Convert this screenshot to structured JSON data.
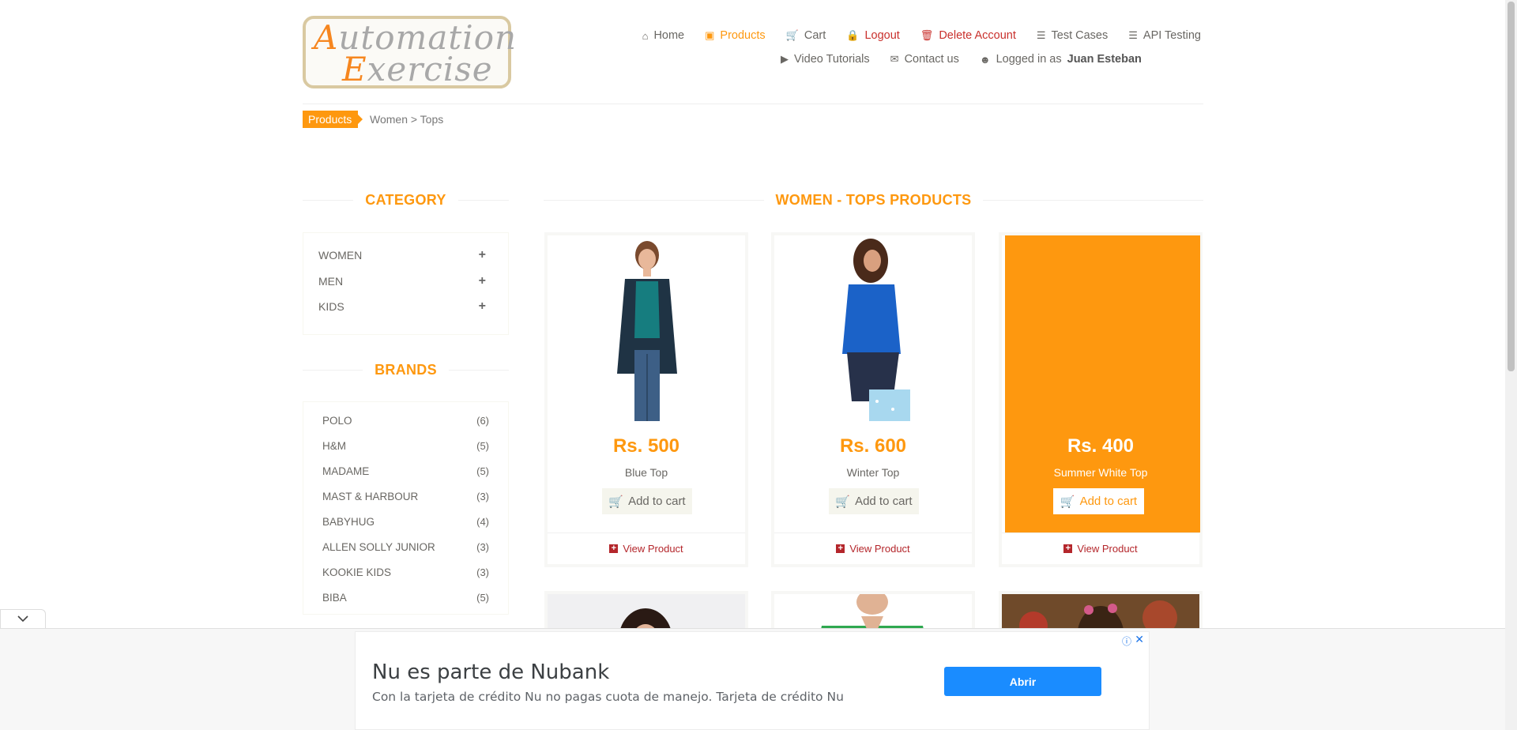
{
  "logo": {
    "line1_cap": "A",
    "line1_rest": "utomation",
    "line2_cap": "E",
    "line2_rest": "xercise"
  },
  "nav": {
    "home": "Home",
    "products": "Products",
    "cart": "Cart",
    "logout": "Logout",
    "delete_account": "Delete Account",
    "test_cases": "Test Cases",
    "api_testing": "API Testing",
    "video_tutorials": "Video Tutorials",
    "contact_us": "Contact us",
    "logged_in_prefix": "Logged in as",
    "logged_in_user": "Juan Esteban"
  },
  "breadcrumb": {
    "tag": "Products",
    "path": "Women > Tops"
  },
  "sidebar": {
    "category_title": "CATEGORY",
    "categories": [
      {
        "label": "WOMEN",
        "icon": "plus-icon"
      },
      {
        "label": "MEN",
        "icon": "plus-icon"
      },
      {
        "label": "KIDS",
        "icon": "plus-icon"
      }
    ],
    "brands_title": "BRANDS",
    "brands": [
      {
        "label": "POLO",
        "count": "(6)"
      },
      {
        "label": "H&M",
        "count": "(5)"
      },
      {
        "label": "MADAME",
        "count": "(5)"
      },
      {
        "label": "MAST & HARBOUR",
        "count": "(3)"
      },
      {
        "label": "BABYHUG",
        "count": "(4)"
      },
      {
        "label": "ALLEN SOLLY JUNIOR",
        "count": "(3)"
      },
      {
        "label": "KOOKIE KIDS",
        "count": "(3)"
      },
      {
        "label": "BIBA",
        "count": "(5)"
      }
    ]
  },
  "main": {
    "title": "WOMEN - TOPS PRODUCTS",
    "products": [
      {
        "price": "Rs. 500",
        "name": "Blue Top",
        "add_to_cart": "Add to cart",
        "view": "View Product"
      },
      {
        "price": "Rs. 600",
        "name": "Winter Top",
        "add_to_cart": "Add to cart",
        "view": "View Product"
      },
      {
        "price": "Rs. 400",
        "name": "Summer White Top",
        "add_to_cart": "Add to cart",
        "view": "View Product"
      }
    ]
  },
  "ad": {
    "title": "Nu es parte de Nubank",
    "text": "Con la tarjeta de crédito Nu no pagas cuota de manejo. Tarjeta de crédito Nu",
    "button": "Abrir"
  },
  "colors": {
    "accent": "#fe980f",
    "danger": "#c9302c",
    "ad_button": "#1a8cff"
  }
}
